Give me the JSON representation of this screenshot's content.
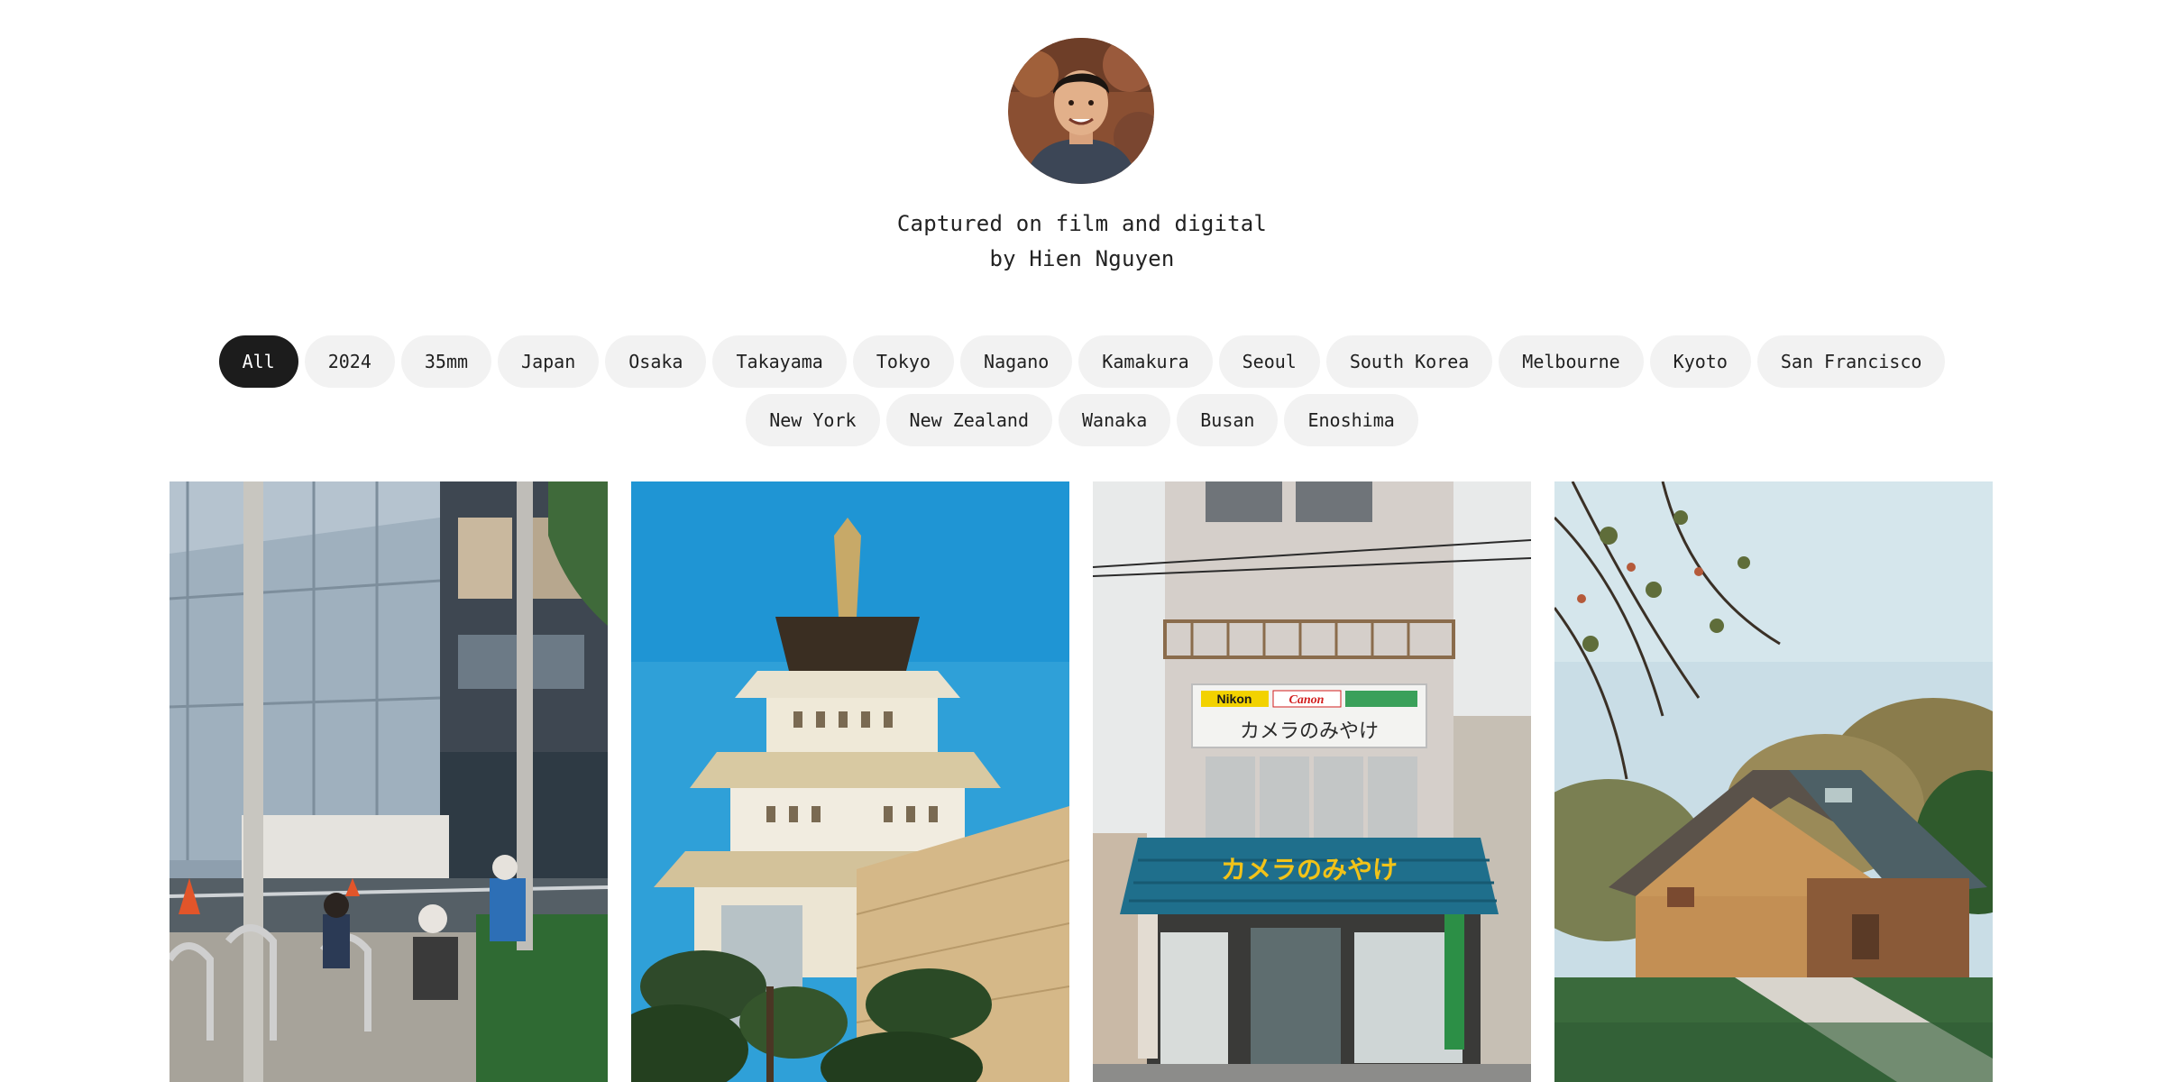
{
  "profile": {
    "tagline_line1": "Captured on film and digital",
    "tagline_line2": "by Hien Nguyen"
  },
  "filters": {
    "active": "All",
    "items": [
      "All",
      "2024",
      "35mm",
      "Japan",
      "Osaka",
      "Takayama",
      "Tokyo",
      "Nagano",
      "Kamakura",
      "Seoul",
      "South Korea",
      "Melbourne",
      "Kyoto",
      "San Francisco",
      "New York",
      "New Zealand",
      "Wanaka",
      "Busan",
      "Enoshima"
    ]
  },
  "photos": [
    {
      "subject": "street-construction-photo"
    },
    {
      "subject": "castle-photo"
    },
    {
      "subject": "camera-shop-photo"
    },
    {
      "subject": "wooden-cabin-photo"
    }
  ],
  "shop_sign": {
    "brand1": "Nikon",
    "brand2": "Canon",
    "name": "カメラのみやけ"
  },
  "colors": {
    "chip_bg": "#f2f2f2",
    "chip_active_bg": "#1c1c1c",
    "chip_active_text": "#ffffff"
  }
}
